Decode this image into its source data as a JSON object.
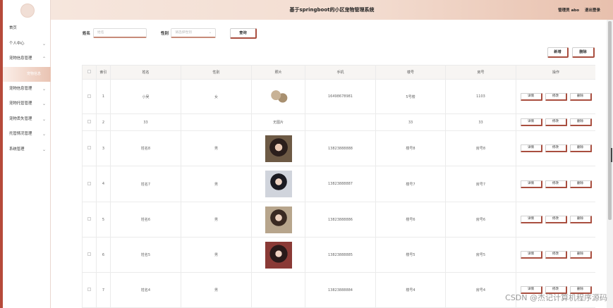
{
  "app": {
    "title": "基于springboot的小区宠物管理系统",
    "user_label": "管理员 abo",
    "logout_label": "退出登录"
  },
  "sidebar": {
    "items": [
      {
        "label": "首页",
        "has_chevron": false
      },
      {
        "label": "个人中心",
        "has_chevron": true,
        "chevron": "⌄"
      },
      {
        "label": "宠物信息管理",
        "has_chevron": true,
        "chevron": "⌃"
      },
      {
        "label": "宠物信息",
        "sub": true
      },
      {
        "label": "宠物信息管理",
        "has_chevron": true,
        "chevron": "⌄"
      },
      {
        "label": "宠物托管管理",
        "has_chevron": true,
        "chevron": "⌄"
      },
      {
        "label": "宠物丢失管理",
        "has_chevron": true,
        "chevron": "⌄"
      },
      {
        "label": "托管情况管理",
        "has_chevron": true,
        "chevron": "⌄"
      },
      {
        "label": "系统管理",
        "has_chevron": true,
        "chevron": "⌄"
      }
    ]
  },
  "search": {
    "name_label": "姓名",
    "name_placeholder": "姓名",
    "gender_label": "性别",
    "gender_placeholder": "请选择性别",
    "query_label": "查询"
  },
  "toolbar": {
    "add_label": "新增",
    "delete_label": "删除"
  },
  "table": {
    "headers": [
      "",
      "索引",
      "姓名",
      "性别",
      "照片",
      "手机",
      "楼号",
      "房号",
      "操作"
    ],
    "actions": {
      "detail": "详情",
      "edit": "修改",
      "delete": "删除"
    },
    "rows": [
      {
        "index": "1",
        "name": "小吴",
        "gender": "女",
        "photo": "cat",
        "phone": "16498678981",
        "building": "5号楼",
        "room": "1103"
      },
      {
        "index": "2",
        "name": "33",
        "gender": "",
        "photo": "无图片",
        "phone": "",
        "building": "33",
        "room": "33"
      },
      {
        "index": "3",
        "name": "姓名8",
        "gender": "男",
        "photo": "person1",
        "phone": "13823888888",
        "building": "楼号8",
        "room": "房号8"
      },
      {
        "index": "4",
        "name": "姓名7",
        "gender": "男",
        "photo": "person2",
        "phone": "13823888887",
        "building": "楼号7",
        "room": "房号7"
      },
      {
        "index": "5",
        "name": "姓名6",
        "gender": "男",
        "photo": "person3",
        "phone": "13823888886",
        "building": "楼号6",
        "room": "房号6"
      },
      {
        "index": "6",
        "name": "姓名5",
        "gender": "男",
        "photo": "person4",
        "phone": "13823888885",
        "building": "楼号5",
        "room": "房号5"
      },
      {
        "index": "7",
        "name": "姓名4",
        "gender": "男",
        "photo": "",
        "phone": "13823888884",
        "building": "楼号4",
        "room": "房号4"
      }
    ]
  },
  "watermark": "CSDN @杰记计算机程序源码",
  "colors": {
    "accent": "#a94e3f",
    "header_start": "#f6e6dd",
    "header_end": "#e8c0ad"
  }
}
